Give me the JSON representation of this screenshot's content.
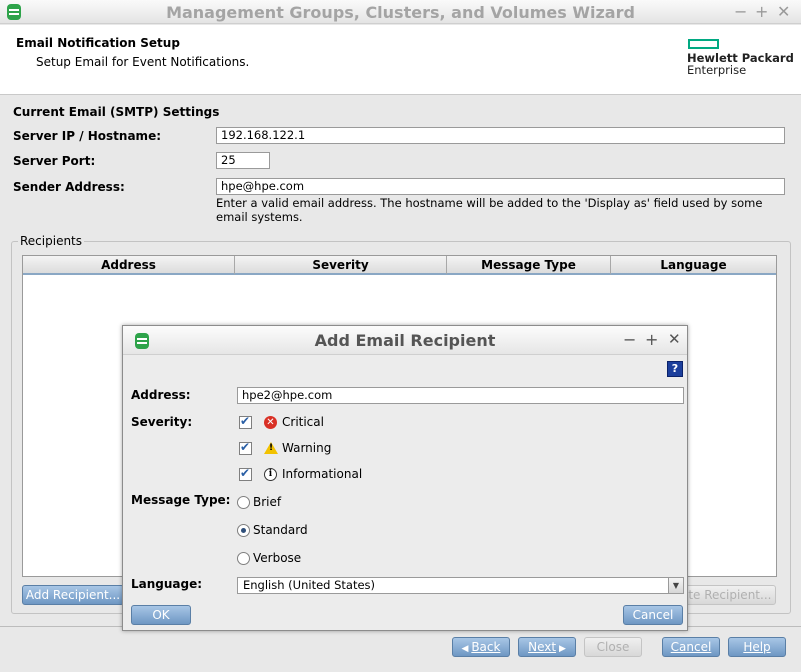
{
  "window": {
    "title": "Management Groups, Clusters, and Volumes Wizard",
    "controls": [
      "−",
      "+",
      "✕"
    ]
  },
  "header": {
    "title": "Email Notification Setup",
    "subtitle": "Setup Email for Event Notifications.",
    "logo_line1": "Hewlett Packard",
    "logo_line2": "Enterprise",
    "logo_color": "#01a982"
  },
  "smtp": {
    "section_title": "Current Email (SMTP) Settings",
    "server_label": "Server IP / Hostname:",
    "server_value": "192.168.122.1",
    "port_label": "Server Port:",
    "port_value": "25",
    "sender_label": "Sender Address:",
    "sender_value": "hpe@hpe.com",
    "sender_note": "Enter a valid email address. The hostname will be added to the 'Display as' field used by some email systems."
  },
  "recipients": {
    "group_label": "Recipients",
    "columns": [
      "Address",
      "Severity",
      "Message Type",
      "Language"
    ],
    "add_button": "Add Recipient...",
    "delete_button": "Delete Recipient..."
  },
  "footer": {
    "back": "Back",
    "next": "Next",
    "close": "Close",
    "cancel": "Cancel",
    "help": "Help"
  },
  "dialog": {
    "title": "Add Email Recipient",
    "controls": [
      "−",
      "+",
      "✕"
    ],
    "help_icon": "?",
    "address_label": "Address:",
    "address_value": "hpe2@hpe.com",
    "severity_label": "Severity:",
    "severities": [
      {
        "label": "Critical",
        "checked": true,
        "icon": "error-icon"
      },
      {
        "label": "Warning",
        "checked": true,
        "icon": "warning-icon"
      },
      {
        "label": "Informational",
        "checked": true,
        "icon": "info-icon"
      }
    ],
    "message_type_label": "Message Type:",
    "message_types": [
      {
        "label": "Brief",
        "selected": false
      },
      {
        "label": "Standard",
        "selected": true
      },
      {
        "label": "Verbose",
        "selected": false
      }
    ],
    "language_label": "Language:",
    "language_value": "English (United States)",
    "ok": "OK",
    "cancel": "Cancel"
  }
}
